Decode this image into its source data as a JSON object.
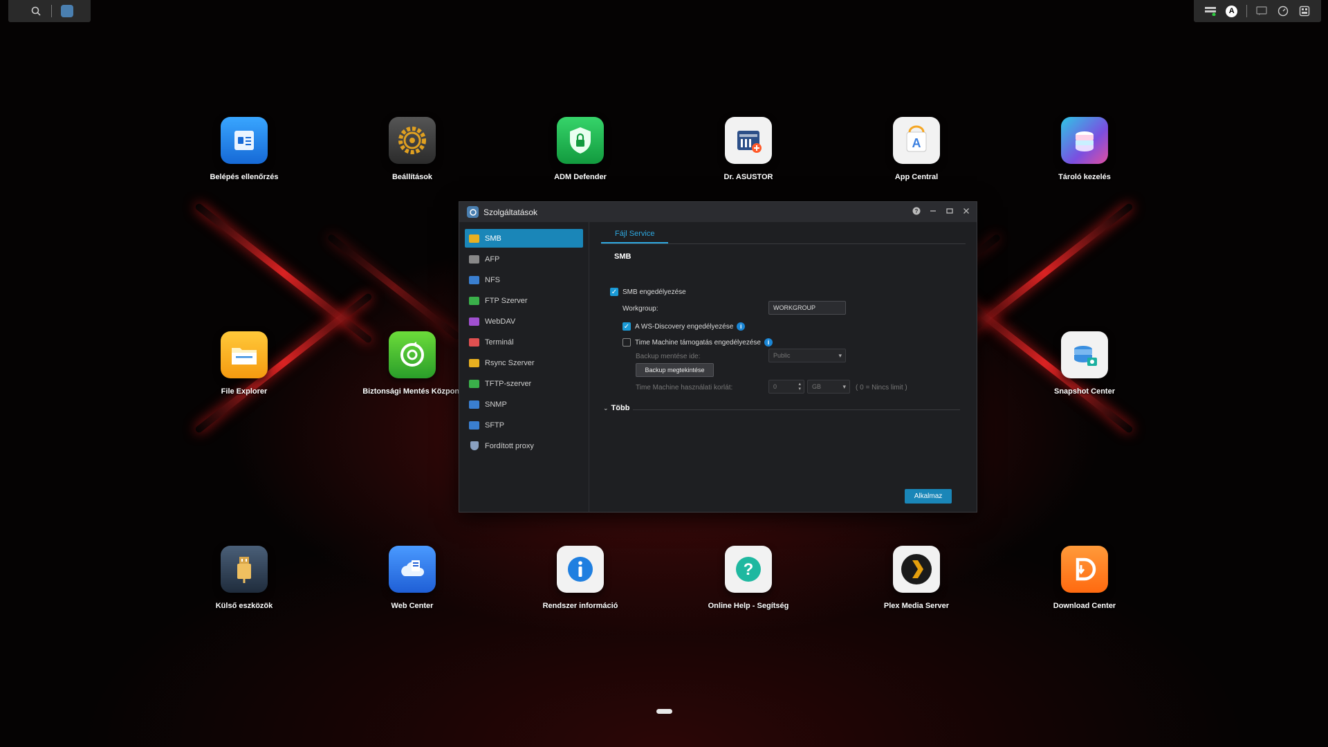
{
  "topbar": {
    "search_icon": "search-icon",
    "right_icons": [
      "task-monitor-icon",
      "user-avatar-icon",
      "message-icon",
      "dashboard-icon",
      "widget-icon"
    ],
    "avatar_letter": "A"
  },
  "desktop": {
    "apps": [
      {
        "label": "Belépés ellenőrzés",
        "icon": "login-audit-icon",
        "color": "#1e8fe6"
      },
      {
        "label": "Beállítások",
        "icon": "gear-icon",
        "color": "#3a3a3a"
      },
      {
        "label": "ADM Defender",
        "icon": "shield-lock-icon",
        "color": "#1fb24a"
      },
      {
        "label": "Dr. ASUSTOR",
        "icon": "doctor-icon",
        "color": "#f0f0f0"
      },
      {
        "label": "App Central",
        "icon": "app-store-icon",
        "color": "#f2f2f2"
      },
      {
        "label": "Tároló kezelés",
        "icon": "storage-icon",
        "color": "#7a4fe0"
      },
      {
        "label": "File Explorer",
        "icon": "folder-icon",
        "color": "#f5a623"
      },
      {
        "label": "Biztonsági Mentés Központ",
        "icon": "backup-icon",
        "color": "#3cb83c"
      },
      {
        "label": "Snapshot Center",
        "icon": "snapshot-icon",
        "color": "#f0f0f0"
      },
      {
        "label": "Külső eszközök",
        "icon": "usb-icon",
        "color": "#2c3e50"
      },
      {
        "label": "Web Center",
        "icon": "web-icon",
        "color": "#2f7de0"
      },
      {
        "label": "Rendszer információ",
        "icon": "info-icon",
        "color": "#f2f2f2"
      },
      {
        "label": "Online Help - Segítség",
        "icon": "help-icon",
        "color": "#f2f2f2"
      },
      {
        "label": "Plex Media Server",
        "icon": "plex-icon",
        "color": "#1a1a1a"
      },
      {
        "label": "Download Center",
        "icon": "download-icon",
        "color": "#ff7a1a"
      }
    ]
  },
  "window": {
    "title": "Szolgáltatások",
    "controls": [
      "help-icon",
      "minimize-icon",
      "maximize-icon",
      "close-icon"
    ],
    "sidebar": [
      {
        "label": "SMB",
        "color": "#e8b020",
        "active": true
      },
      {
        "label": "AFP",
        "color": "#888888"
      },
      {
        "label": "NFS",
        "color": "#3a7fd0"
      },
      {
        "label": "FTP Szerver",
        "color": "#3ab04a"
      },
      {
        "label": "WebDAV",
        "color": "#a050d0"
      },
      {
        "label": "Terminál",
        "color": "#e05050"
      },
      {
        "label": "Rsync Szerver",
        "color": "#e8b020"
      },
      {
        "label": "TFTP-szerver",
        "color": "#3ab04a"
      },
      {
        "label": "SNMP",
        "color": "#3a7fd0"
      },
      {
        "label": "SFTP",
        "color": "#3a7fd0"
      },
      {
        "label": "Fordított proxy",
        "color": "#8aa0c0"
      }
    ],
    "tab": "Fájl Service",
    "section_title": "SMB",
    "smb_enable": "SMB engedélyezése",
    "workgroup_label": "Workgroup:",
    "workgroup_value": "WORKGROUP",
    "ws_discovery": "A WS-Discovery engedélyezése",
    "time_machine": "Time Machine támogatás engedélyezése",
    "backup_to_label": "Backup mentése ide:",
    "backup_to_value": "Public",
    "backup_view_button": "Backup megtekintése",
    "tm_limit_label": "Time Machine használati korlát:",
    "tm_limit_value": "0",
    "tm_limit_unit": "GB",
    "tm_limit_note": "( 0 = Nincs limit )",
    "more": "Több",
    "apply_button": "Alkalmaz",
    "info_glyph": "i"
  }
}
